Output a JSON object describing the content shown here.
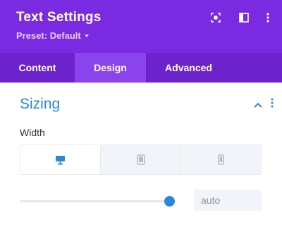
{
  "header": {
    "title": "Text Settings",
    "preset_label": "Preset: Default",
    "bg_color": "#7a2ae0"
  },
  "header_icons": [
    "focus-icon",
    "split-view-icon",
    "more-vertical-icon"
  ],
  "tabs": [
    {
      "label": "Content",
      "active": false
    },
    {
      "label": "Design",
      "active": true
    },
    {
      "label": "Advanced",
      "active": false
    }
  ],
  "section": {
    "title": "Sizing",
    "expanded": true
  },
  "width_field": {
    "label": "Width",
    "devices": [
      {
        "name": "desktop",
        "active": true
      },
      {
        "name": "tablet",
        "active": false
      },
      {
        "name": "phone",
        "active": false
      }
    ],
    "slider_level": 1.0,
    "value": "auto"
  },
  "colors": {
    "accent": "#2b87da",
    "tab_bar": "#6c22cc",
    "tab_active": "#8b43f0"
  }
}
